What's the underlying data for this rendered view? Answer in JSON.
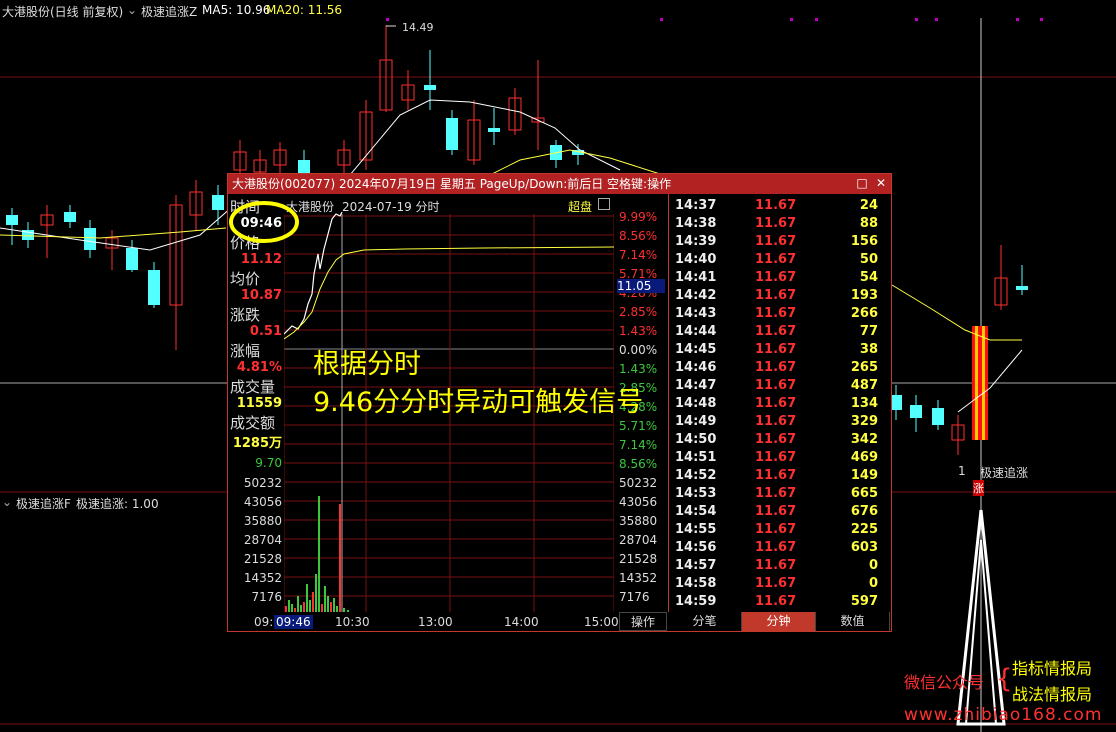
{
  "main_title": {
    "name": "大港股份(日线 前复权)",
    "indicator": "极速追涨Z",
    "ma5": "MA5: 10.96",
    "ma20": "MA20: 11.56"
  },
  "high_label": "14.49",
  "sub_indicator": {
    "name": "极速追涨F",
    "value": "极速追涨: 1.00"
  },
  "signal_label": "极速追涨",
  "signal_char": "涨",
  "signal_prefix": "1",
  "popup": {
    "header": "大港股份(002077) 2024年07月19日 星期五 PageUp/Down:前后日 空格键:操作",
    "chart_title": "大港股份",
    "chart_subtitle": "2024-07-19 分时",
    "chart_tag": "超盘",
    "left": {
      "time_label": "时间",
      "time_value": "09:46",
      "price_label": "价格",
      "price_value": "11.12",
      "avg_label": "均价",
      "avg_value": "10.87",
      "change_label": "涨跌",
      "change_value": "0.51",
      "pct_label": "涨幅",
      "pct_value": "4.81%",
      "vol_label": "成交量",
      "vol_value": "11559",
      "amt_label": "成交额",
      "amt_value": "1285万",
      "low_price": "9.70"
    },
    "price_axis_right": [
      "9.99%",
      "8.56%",
      "7.14%",
      "5.71%",
      "4.28%",
      "2.85%",
      "1.43%",
      "0.00%",
      "1.43%",
      "2.85%",
      "4.28%",
      "5.71%",
      "7.14%",
      "8.56%"
    ],
    "price_marker": "11.05",
    "volume_axis": [
      "50232",
      "43056",
      "35880",
      "28704",
      "21528",
      "14352",
      "7176"
    ],
    "x_ticks": [
      "09:30",
      "09:46",
      "10:30",
      "13:00",
      "14:00",
      "15:00"
    ],
    "operate_label": "操作",
    "tabs": [
      "分笔",
      "分钟",
      "数值"
    ],
    "active_tab": "分钟",
    "ticks": [
      {
        "time": "14:37",
        "price": "11.67",
        "vol": "24"
      },
      {
        "time": "14:38",
        "price": "11.67",
        "vol": "88"
      },
      {
        "time": "14:39",
        "price": "11.67",
        "vol": "156"
      },
      {
        "time": "14:40",
        "price": "11.67",
        "vol": "50"
      },
      {
        "time": "14:41",
        "price": "11.67",
        "vol": "54"
      },
      {
        "time": "14:42",
        "price": "11.67",
        "vol": "193"
      },
      {
        "time": "14:43",
        "price": "11.67",
        "vol": "266"
      },
      {
        "time": "14:44",
        "price": "11.67",
        "vol": "77"
      },
      {
        "time": "14:45",
        "price": "11.67",
        "vol": "38"
      },
      {
        "time": "14:46",
        "price": "11.67",
        "vol": "265"
      },
      {
        "time": "14:47",
        "price": "11.67",
        "vol": "487"
      },
      {
        "time": "14:48",
        "price": "11.67",
        "vol": "134"
      },
      {
        "time": "14:49",
        "price": "11.67",
        "vol": "329"
      },
      {
        "time": "14:50",
        "price": "11.67",
        "vol": "342"
      },
      {
        "time": "14:51",
        "price": "11.67",
        "vol": "469"
      },
      {
        "time": "14:52",
        "price": "11.67",
        "vol": "149"
      },
      {
        "time": "14:53",
        "price": "11.67",
        "vol": "665"
      },
      {
        "time": "14:54",
        "price": "11.67",
        "vol": "676"
      },
      {
        "time": "14:55",
        "price": "11.67",
        "vol": "225"
      },
      {
        "time": "14:56",
        "price": "11.67",
        "vol": "603"
      },
      {
        "time": "14:57",
        "price": "11.67",
        "vol": "0"
      },
      {
        "time": "14:58",
        "price": "11.67",
        "vol": "0"
      },
      {
        "time": "14:59",
        "price": "11.67",
        "vol": "597"
      }
    ]
  },
  "annotation": {
    "line1": "根据分时",
    "line2": "9.46分分时异动可触发信号"
  },
  "watermark": {
    "wechat": "微信公众号",
    "brand1": "指标情报局",
    "brand2": "战法情报局",
    "site": "www.zhibiao168.com"
  },
  "colors": {
    "up": "#ff3030",
    "down": "#54ffff",
    "ma5": "#ffffff",
    "ma20": "#ffff40",
    "frame": "#c0392b"
  }
}
